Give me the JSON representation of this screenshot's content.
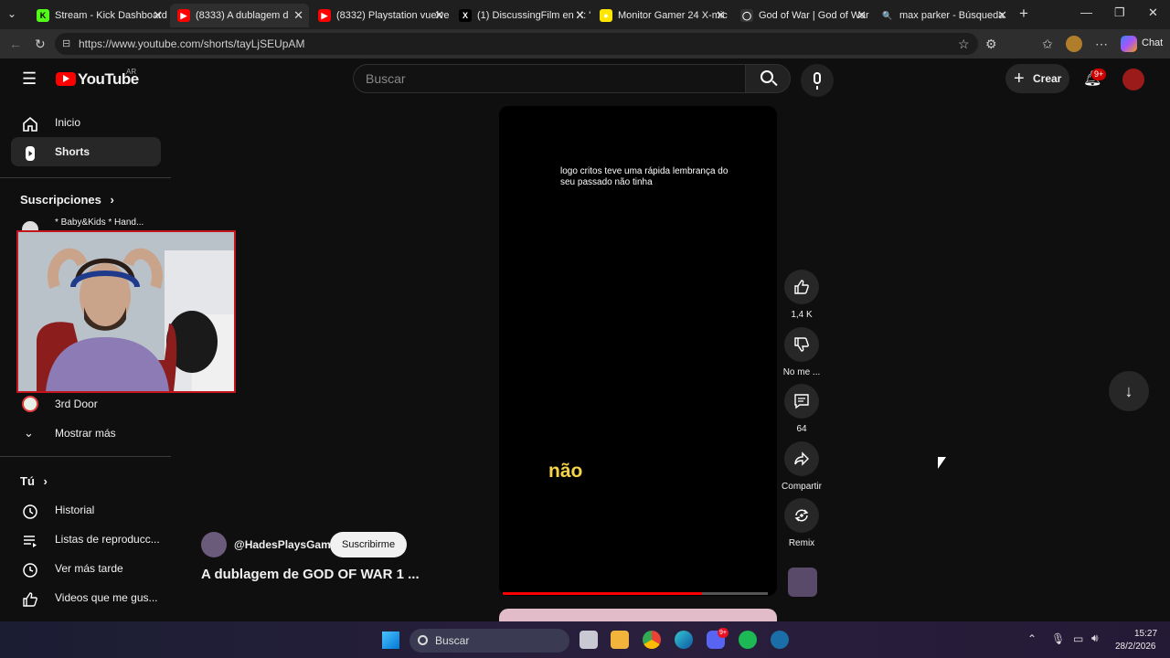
{
  "browser": {
    "tabs": [
      {
        "title": "Stream - Kick Dashboard",
        "fav": "K",
        "fav_color": "#53fc18"
      },
      {
        "title": "(8333) A dublagem d",
        "fav": "▶",
        "fav_color": "#ff0000"
      },
      {
        "title": "(8332) Playstation vuelve",
        "fav": "▶",
        "fav_color": "#ff0000"
      },
      {
        "title": "(1) DiscussingFilm en X: \"",
        "fav": "X",
        "fav_color": "#000000"
      },
      {
        "title": "Monitor Gamer 24 X-mic",
        "fav": "●",
        "fav_color": "#ffe600"
      },
      {
        "title": "God of War | God of War",
        "fav": "◯",
        "fav_color": "#333333"
      },
      {
        "title": "max parker - Búsqueda",
        "fav": "🔍",
        "fav_color": "#1f1f1f"
      }
    ],
    "url": "https://www.youtube.com/shorts/tayLjSEUpAM",
    "chat_label": "Chat"
  },
  "youtube": {
    "logo_text": "YouTube",
    "region": "AR",
    "search_placeholder": "Buscar",
    "create_label": "Crear",
    "notif_badge": "9+",
    "sidebar": {
      "items": [
        {
          "label": "Inicio"
        },
        {
          "label": "Shorts"
        }
      ],
      "subs_heading": "Suscripciones",
      "subs": [
        {
          "label": "* Baby&Kids * Hand..."
        },
        {
          "label": "3rd Door"
        }
      ],
      "show_more": "Mostrar más",
      "you_heading": "Tú",
      "you_items": [
        {
          "label": "Historial"
        },
        {
          "label": "Listas de reproducc..."
        },
        {
          "label": "Ver más tarde"
        },
        {
          "label": "Videos que me gus..."
        }
      ]
    },
    "short": {
      "caption": "logo critos teve uma rápida lembrança do seu passado não tinha",
      "big_word": "não",
      "channel": "@HadesPlaysGame",
      "subscribe": "Suscribirme",
      "title": "A dublagem de GOD OF WAR 1 ...",
      "progress": 0.75
    },
    "actions": {
      "likes": "1,4 K",
      "dislike": "No me ...",
      "comments": "64",
      "share": "Compartir",
      "remix": "Remix"
    }
  },
  "taskbar": {
    "search_label": "Buscar",
    "time": "15:27",
    "date": "28/2/2026",
    "discord_badge": "9+"
  }
}
